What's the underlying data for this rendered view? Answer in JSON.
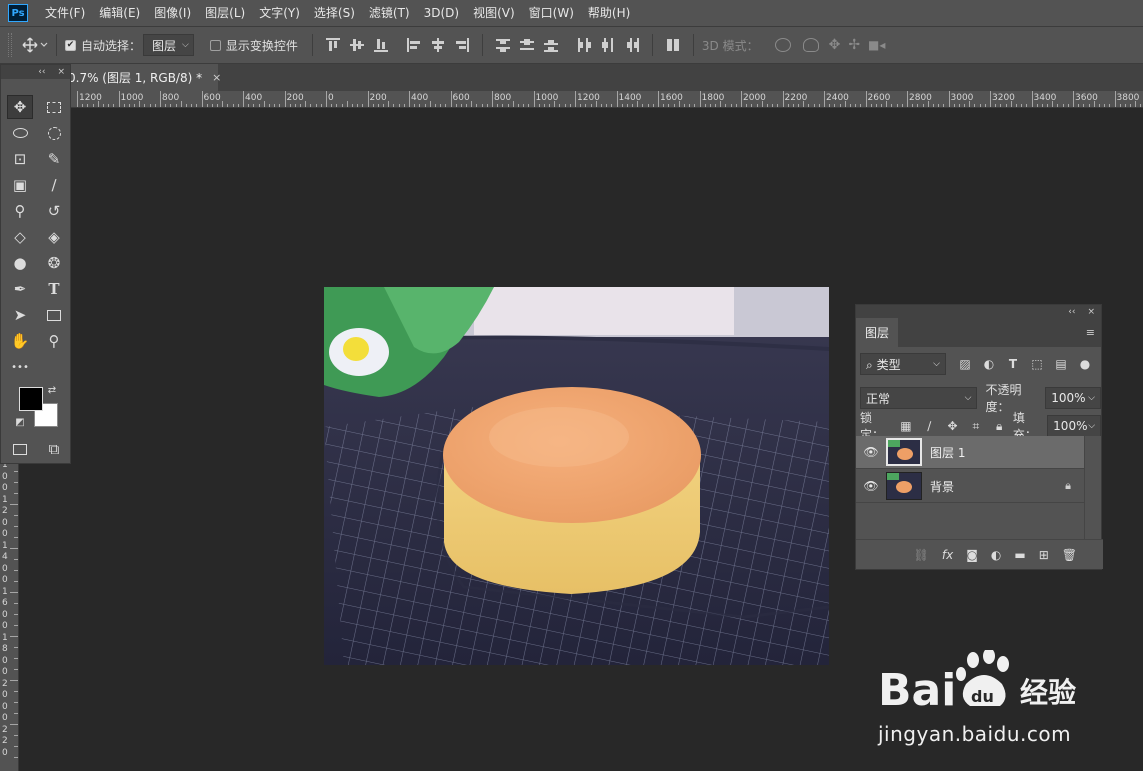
{
  "app": {
    "logo": "Ps"
  },
  "menu": [
    "文件(F)",
    "编辑(E)",
    "图像(I)",
    "图层(L)",
    "文字(Y)",
    "选择(S)",
    "滤镜(T)",
    "3D(D)",
    "视图(V)",
    "窗口(W)",
    "帮助(H)"
  ],
  "options": {
    "auto_select_label": "自动选择：",
    "auto_select_checked": true,
    "auto_select_target": "图层",
    "show_transform_label": "显示变换控件",
    "show_transform_checked": false,
    "mode_3d_label": "3D 模式："
  },
  "document": {
    "tab_title": "0.7% (图层 1, RGB/8) *",
    "close": "×"
  },
  "ruler": {
    "h_labels": [
      "1200",
      "1000",
      "800",
      "600",
      "400",
      "200",
      "0",
      "200",
      "400",
      "600",
      "800",
      "1000",
      "1200",
      "1400",
      "1600",
      "1800",
      "2000",
      "2200",
      "2400",
      "2600",
      "2800",
      "3000",
      "3200",
      "3400",
      "3600",
      "3800"
    ],
    "v_labels": [
      "1",
      "0",
      "0",
      "1",
      "2",
      "0",
      "0",
      "1",
      "4",
      "0",
      "0",
      "1",
      "6",
      "0",
      "0",
      "1",
      "8",
      "0",
      "0",
      "2",
      "0",
      "0",
      "0",
      "2",
      "2",
      "0"
    ]
  },
  "tools_panel": {
    "collapse": "‹‹",
    "close": "×",
    "more": "•••"
  },
  "layers_panel": {
    "tab": "图层",
    "collapse": "‹‹",
    "close": "×",
    "menu": "≡",
    "filter_label": "类型",
    "blend_mode": "正常",
    "opacity_label": "不透明度：",
    "opacity_value": "100%",
    "lock_label": "锁定：",
    "fill_label": "填充：",
    "fill_value": "100%",
    "layers": [
      {
        "name": "图层 1",
        "selected": true,
        "locked": false
      },
      {
        "name": "背景",
        "selected": false,
        "locked": true
      }
    ]
  },
  "watermark": {
    "url_text": "jingyan.baidu.com",
    "brand": "Baidu经验"
  },
  "colors": {
    "foreground": "#000000",
    "background": "#ffffff",
    "ui_dark": "#282828",
    "ui_panel": "#535353"
  }
}
